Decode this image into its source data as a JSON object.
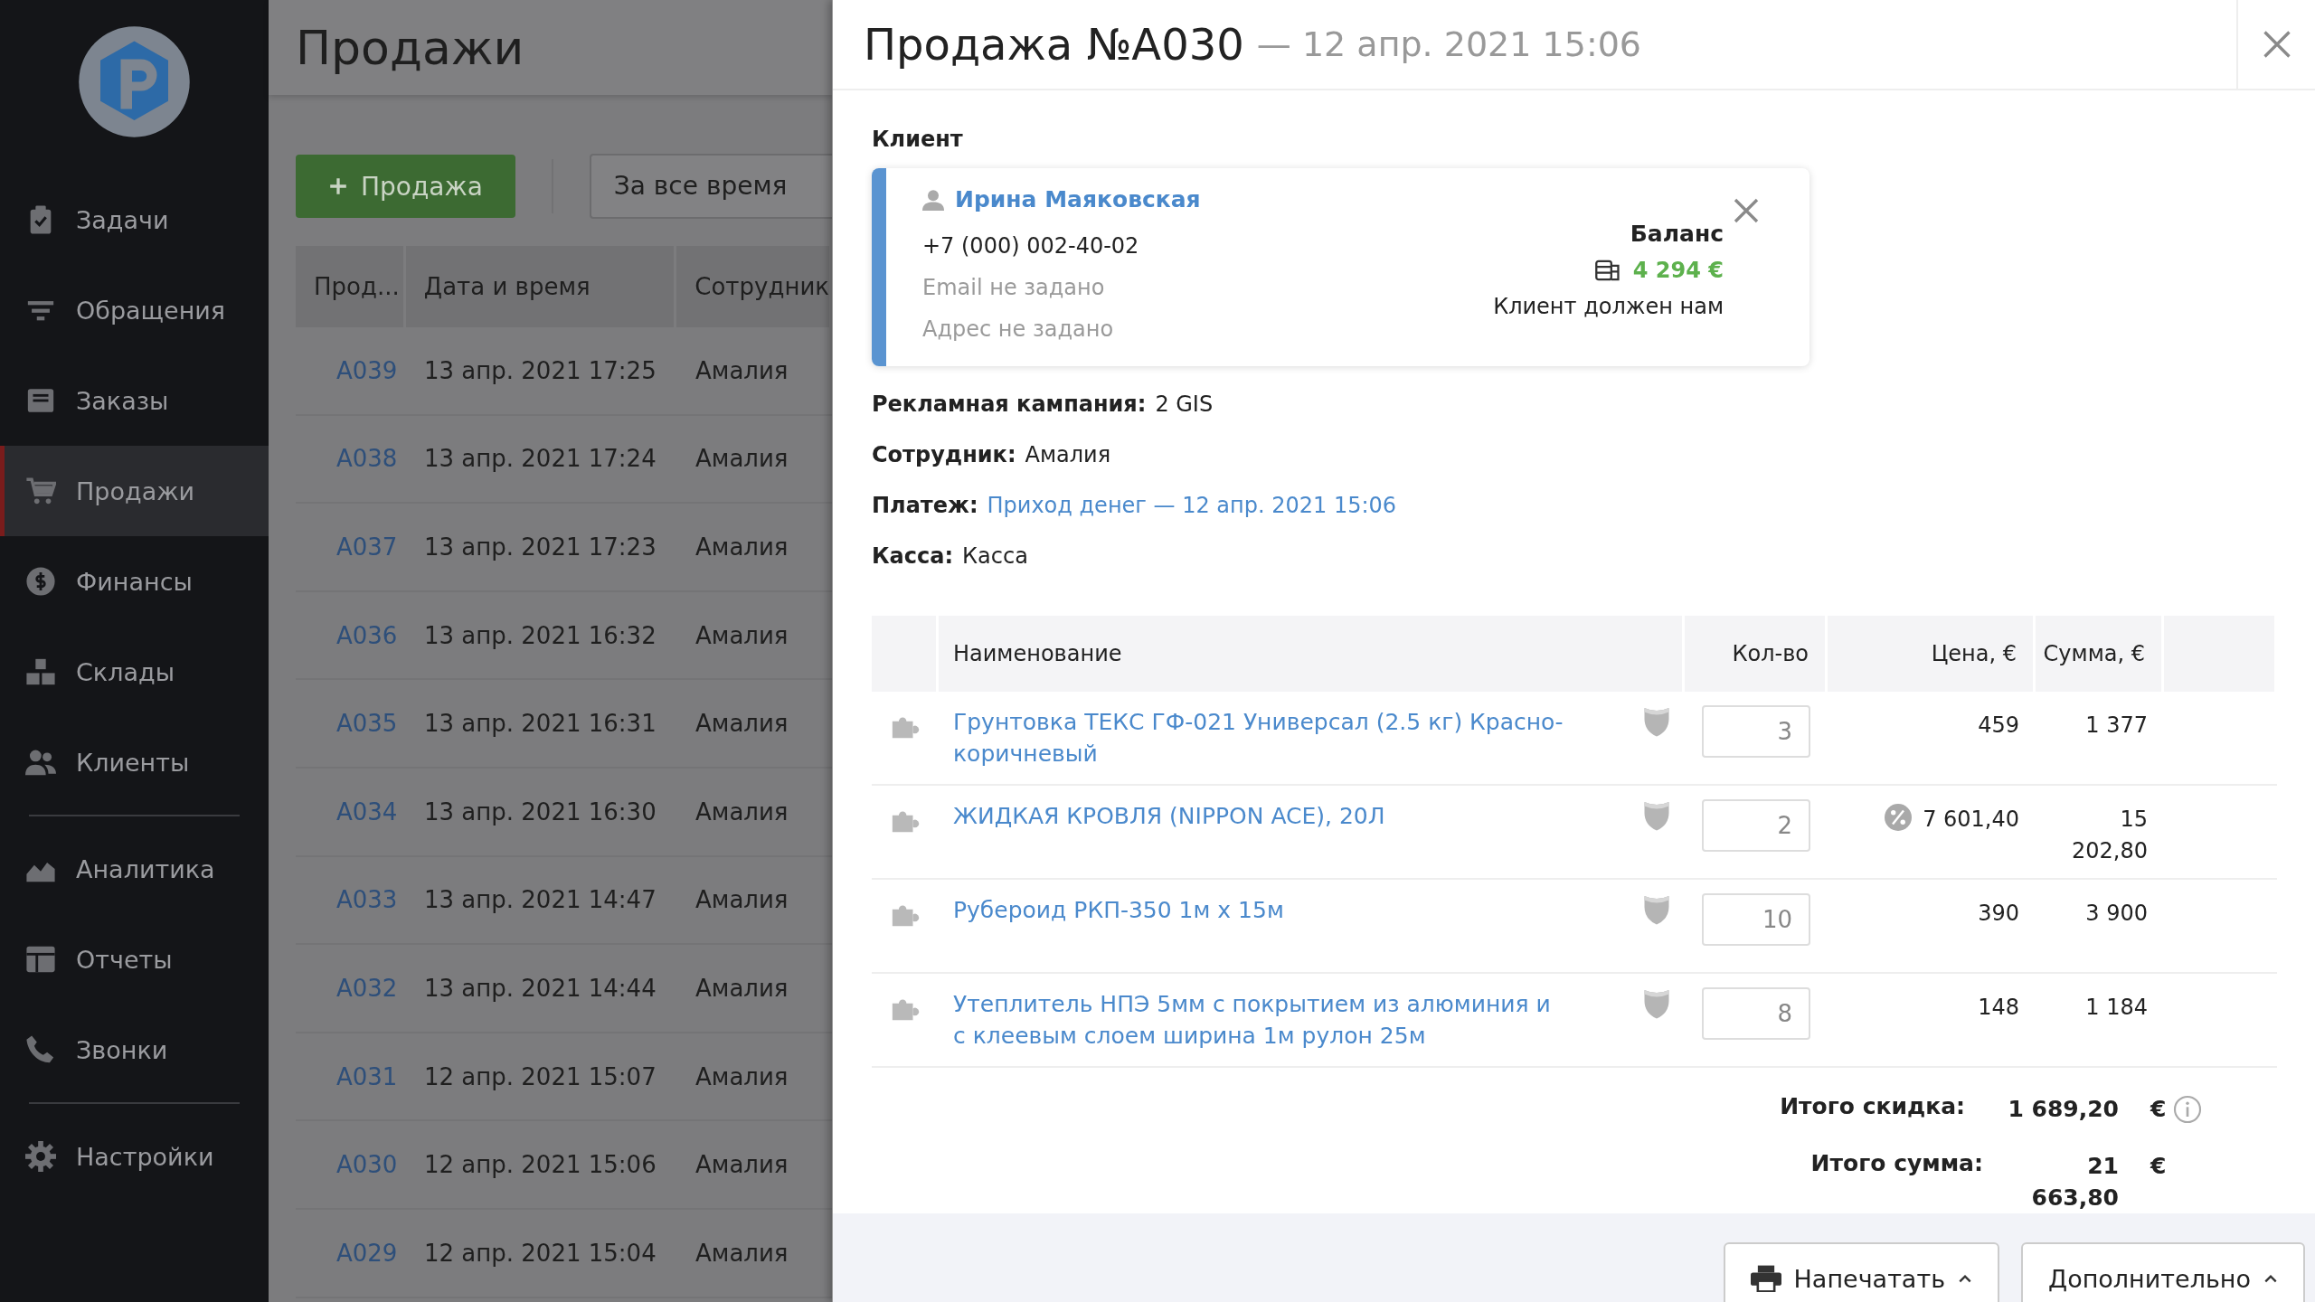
{
  "sidebar": {
    "groups": [
      [
        {
          "label": "Задачи",
          "selected": false
        },
        {
          "label": "Обращения",
          "selected": false
        },
        {
          "label": "Заказы",
          "selected": false
        },
        {
          "label": "Продажи",
          "selected": true
        },
        {
          "label": "Финансы",
          "selected": false
        },
        {
          "label": "Склады",
          "selected": false
        },
        {
          "label": "Клиенты",
          "selected": false
        }
      ],
      [
        {
          "label": "Аналитика",
          "selected": false
        },
        {
          "label": "Отчеты",
          "selected": false
        },
        {
          "label": "Звонки",
          "selected": false
        }
      ],
      [
        {
          "label": "Настройки",
          "selected": false
        }
      ]
    ]
  },
  "sales_list": {
    "title": "Продажи",
    "new_button": "Продажа",
    "period_filter": "За все время",
    "columns": [
      "Прод...",
      "Дата и время",
      "Сотрудник"
    ],
    "rows": [
      {
        "number": "A039",
        "datetime": "13 апр. 2021 17:25",
        "employee": "Амалия"
      },
      {
        "number": "A038",
        "datetime": "13 апр. 2021 17:24",
        "employee": "Амалия"
      },
      {
        "number": "A037",
        "datetime": "13 апр. 2021 17:23",
        "employee": "Амалия"
      },
      {
        "number": "A036",
        "datetime": "13 апр. 2021 16:32",
        "employee": "Амалия"
      },
      {
        "number": "A035",
        "datetime": "13 апр. 2021 16:31",
        "employee": "Амалия"
      },
      {
        "number": "A034",
        "datetime": "13 апр. 2021 16:30",
        "employee": "Амалия"
      },
      {
        "number": "A033",
        "datetime": "13 апр. 2021 14:47",
        "employee": "Амалия"
      },
      {
        "number": "A032",
        "datetime": "13 апр. 2021 14:44",
        "employee": "Амалия"
      },
      {
        "number": "A031",
        "datetime": "12 апр. 2021 15:07",
        "employee": "Амалия"
      },
      {
        "number": "A030",
        "datetime": "12 апр. 2021 15:06",
        "employee": "Амалия"
      },
      {
        "number": "A029",
        "datetime": "12 апр. 2021 15:04",
        "employee": "Амалия"
      }
    ]
  },
  "panel": {
    "title": "Продажа №A030",
    "subtitle": "— 12 апр. 2021 15:06",
    "client_label": "Клиент",
    "client": {
      "name": "Ирина Маяковская",
      "phone": "+7 (000) 002-40-02",
      "email": "Email не задано",
      "address": "Адрес не задано",
      "balance_label": "Баланс",
      "balance": "4 294 €",
      "balance_note": "Клиент должен нам"
    },
    "fields": [
      {
        "label": "Рекламная кампания:",
        "value": "2 GIS",
        "kind": "text"
      },
      {
        "label": "Сотрудник:",
        "value": "Амалия",
        "kind": "text"
      },
      {
        "label": "Платеж:",
        "value": "Приход денег — 12 апр. 2021 15:06",
        "kind": "link"
      },
      {
        "label": "Касса:",
        "value": "Касса",
        "kind": "text"
      }
    ],
    "items_table": {
      "columns": [
        "Наименование",
        "Кол-во",
        "Цена, €",
        "Сумма, €"
      ],
      "rows": [
        {
          "name": "Грунтовка ТЕКС ГФ-021 Универсал (2.5 кг) Красно-коричневый",
          "qty": "3",
          "price": "459",
          "sum": "1 377",
          "discount": false
        },
        {
          "name": "ЖИДКАЯ КРОВЛЯ (NIPPON ACE), 20Л",
          "qty": "2",
          "price": "7 601,40",
          "sum": "15 202,80",
          "discount": true
        },
        {
          "name": "Рубероид РКП-350 1м х 15м",
          "qty": "10",
          "price": "390",
          "sum": "3 900",
          "discount": false
        },
        {
          "name": "Утеплитель НПЭ 5мм с покрытием из алюминия и с клеевым слоем ширина 1м рулон 25м",
          "qty": "8",
          "price": "148",
          "sum": "1 184",
          "discount": false
        }
      ]
    },
    "totals": [
      {
        "label": "Итого скидка:",
        "value": "1 689,20",
        "currency": "€",
        "info": true
      },
      {
        "label": "Итого сумма:",
        "value": "21 663,80",
        "currency": "€",
        "info": false
      }
    ],
    "footer_buttons": [
      {
        "label": "Напечатать",
        "has_icon": true
      },
      {
        "label": "Дополнительно",
        "has_icon": false
      }
    ]
  }
}
